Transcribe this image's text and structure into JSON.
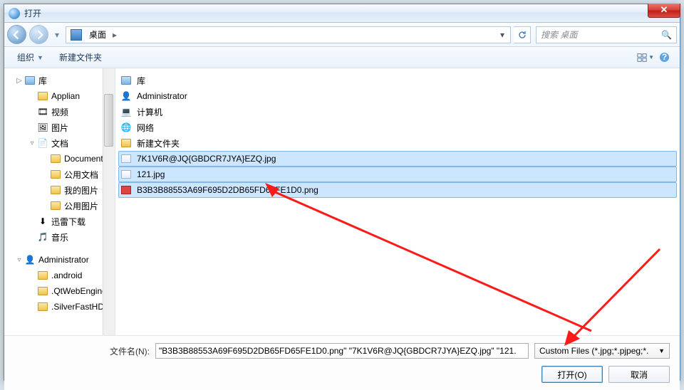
{
  "title": "打开",
  "nav": {
    "path_root": "桌面",
    "search_placeholder": "搜索 桌面"
  },
  "toolbar": {
    "organize": "组织",
    "newfolder": "新建文件夹"
  },
  "tree": [
    {
      "lvl": 1,
      "exp": "▷",
      "ico": "lib",
      "label": "库"
    },
    {
      "lvl": 2,
      "exp": "",
      "ico": "folder",
      "label": "Applian"
    },
    {
      "lvl": 2,
      "exp": "",
      "ico": "video",
      "label": "视频"
    },
    {
      "lvl": 2,
      "exp": "",
      "ico": "pic",
      "label": "图片"
    },
    {
      "lvl": 2,
      "exp": "▿",
      "ico": "doc",
      "label": "文档"
    },
    {
      "lvl": 3,
      "exp": "",
      "ico": "folder",
      "label": "Documents"
    },
    {
      "lvl": 3,
      "exp": "",
      "ico": "folder",
      "label": "公用文档"
    },
    {
      "lvl": 3,
      "exp": "",
      "ico": "folder",
      "label": "我的图片"
    },
    {
      "lvl": 3,
      "exp": "",
      "ico": "folder",
      "label": "公用图片"
    },
    {
      "lvl": 2,
      "exp": "",
      "ico": "dl",
      "label": "迅雷下载"
    },
    {
      "lvl": 2,
      "exp": "",
      "ico": "music",
      "label": "音乐"
    },
    {
      "lvl": 1,
      "exp": "▿",
      "ico": "user",
      "label": "Administrator"
    },
    {
      "lvl": 2,
      "exp": "",
      "ico": "folder",
      "label": ".android"
    },
    {
      "lvl": 2,
      "exp": "",
      "ico": "folder",
      "label": ".QtWebEngine"
    },
    {
      "lvl": 2,
      "exp": "",
      "ico": "folder",
      "label": ".SilverFastHDR"
    }
  ],
  "files": [
    {
      "ico": "lib",
      "label": "库",
      "sel": false
    },
    {
      "ico": "user",
      "label": "Administrator",
      "sel": false
    },
    {
      "ico": "pc",
      "label": "计算机",
      "sel": false
    },
    {
      "ico": "net",
      "label": "网络",
      "sel": false
    },
    {
      "ico": "folder",
      "label": "新建文件夹",
      "sel": false
    },
    {
      "ico": "img",
      "label": "7K1V6R@JQ{GBDCR7JYA}EZQ.jpg",
      "sel": true
    },
    {
      "ico": "img",
      "label": "121.jpg",
      "sel": true
    },
    {
      "ico": "png",
      "label": "B3B3B88553A69F695D2DB65FD65FE1D0.png",
      "sel": true
    }
  ],
  "bottom": {
    "filename_label": "文件名(N):",
    "filename_value": "\"B3B3B88553A69F695D2DB65FD65FE1D0.png\" \"7K1V6R@JQ{GBDCR7JYA}EZQ.jpg\" \"121.",
    "filter": "Custom Files (*.jpg;*.pjpeg;*.",
    "open": "打开(O)",
    "cancel": "取消"
  }
}
